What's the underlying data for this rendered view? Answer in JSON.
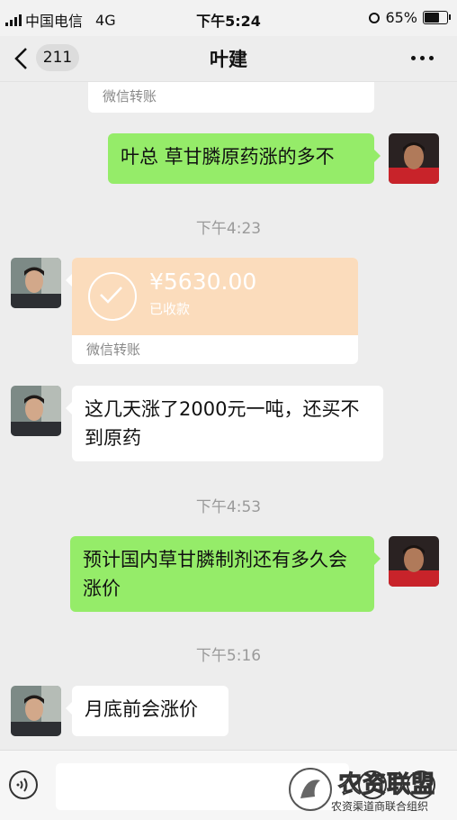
{
  "status_bar": {
    "carrier": "中国电信",
    "network": "4G",
    "time": "下午5:24",
    "battery": "65%"
  },
  "nav": {
    "unread_count": "211",
    "title": "叶建"
  },
  "messages": [
    {
      "type": "transfer_partial",
      "label": "微信转账"
    },
    {
      "type": "text",
      "from": "me",
      "text": "叶总 草甘膦原药涨的多不"
    },
    {
      "type": "time",
      "text": "下午4:23"
    },
    {
      "type": "transfer",
      "from": "other",
      "amount": "¥5630.00",
      "status": "已收款",
      "label": "微信转账"
    },
    {
      "type": "text",
      "from": "other",
      "text": "这几天涨了2000元一吨，还买不到原药"
    },
    {
      "type": "time",
      "text": "下午4:53"
    },
    {
      "type": "text",
      "from": "me",
      "text": "预计国内草甘膦制剂还有多久会涨价"
    },
    {
      "type": "time",
      "text": "下午5:16"
    },
    {
      "type": "text",
      "from": "other",
      "text": "月底前会涨价"
    }
  ],
  "watermark": {
    "line1": "农资联盟",
    "line2": "农资渠道商联合组织"
  },
  "colors": {
    "outgoing_bubble": "#95ec69",
    "incoming_bubble": "#ffffff",
    "transfer_card": "#fbdcbc",
    "background": "#ededed"
  },
  "icons": [
    "back-icon",
    "more-icon",
    "voice-icon",
    "emoji-icon",
    "plus-icon",
    "check-icon"
  ]
}
